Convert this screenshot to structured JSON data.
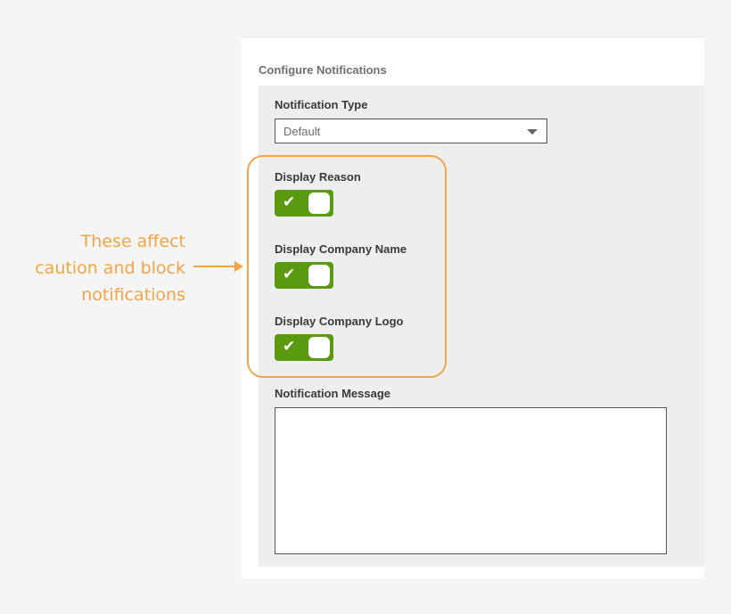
{
  "section": {
    "title": "Configure Notifications"
  },
  "notification_type": {
    "label": "Notification Type",
    "value": "Default"
  },
  "toggles": [
    {
      "label": "Display Reason",
      "checked": true
    },
    {
      "label": "Display Company Name",
      "checked": true
    },
    {
      "label": "Display Company Logo",
      "checked": true
    }
  ],
  "message": {
    "label": "Notification Message",
    "value": ""
  },
  "annotation": {
    "lines": [
      "These  affect",
      "caution and block",
      "notifications"
    ]
  },
  "colors": {
    "toggle_on": "#5a9a10",
    "annotation": "#f5a443",
    "page_bg": "#f5f5f5"
  },
  "icons": {
    "toggle_check": "check-icon",
    "dropdown": "chevron-down-icon",
    "annotation_arrow": "arrow-right-icon"
  }
}
